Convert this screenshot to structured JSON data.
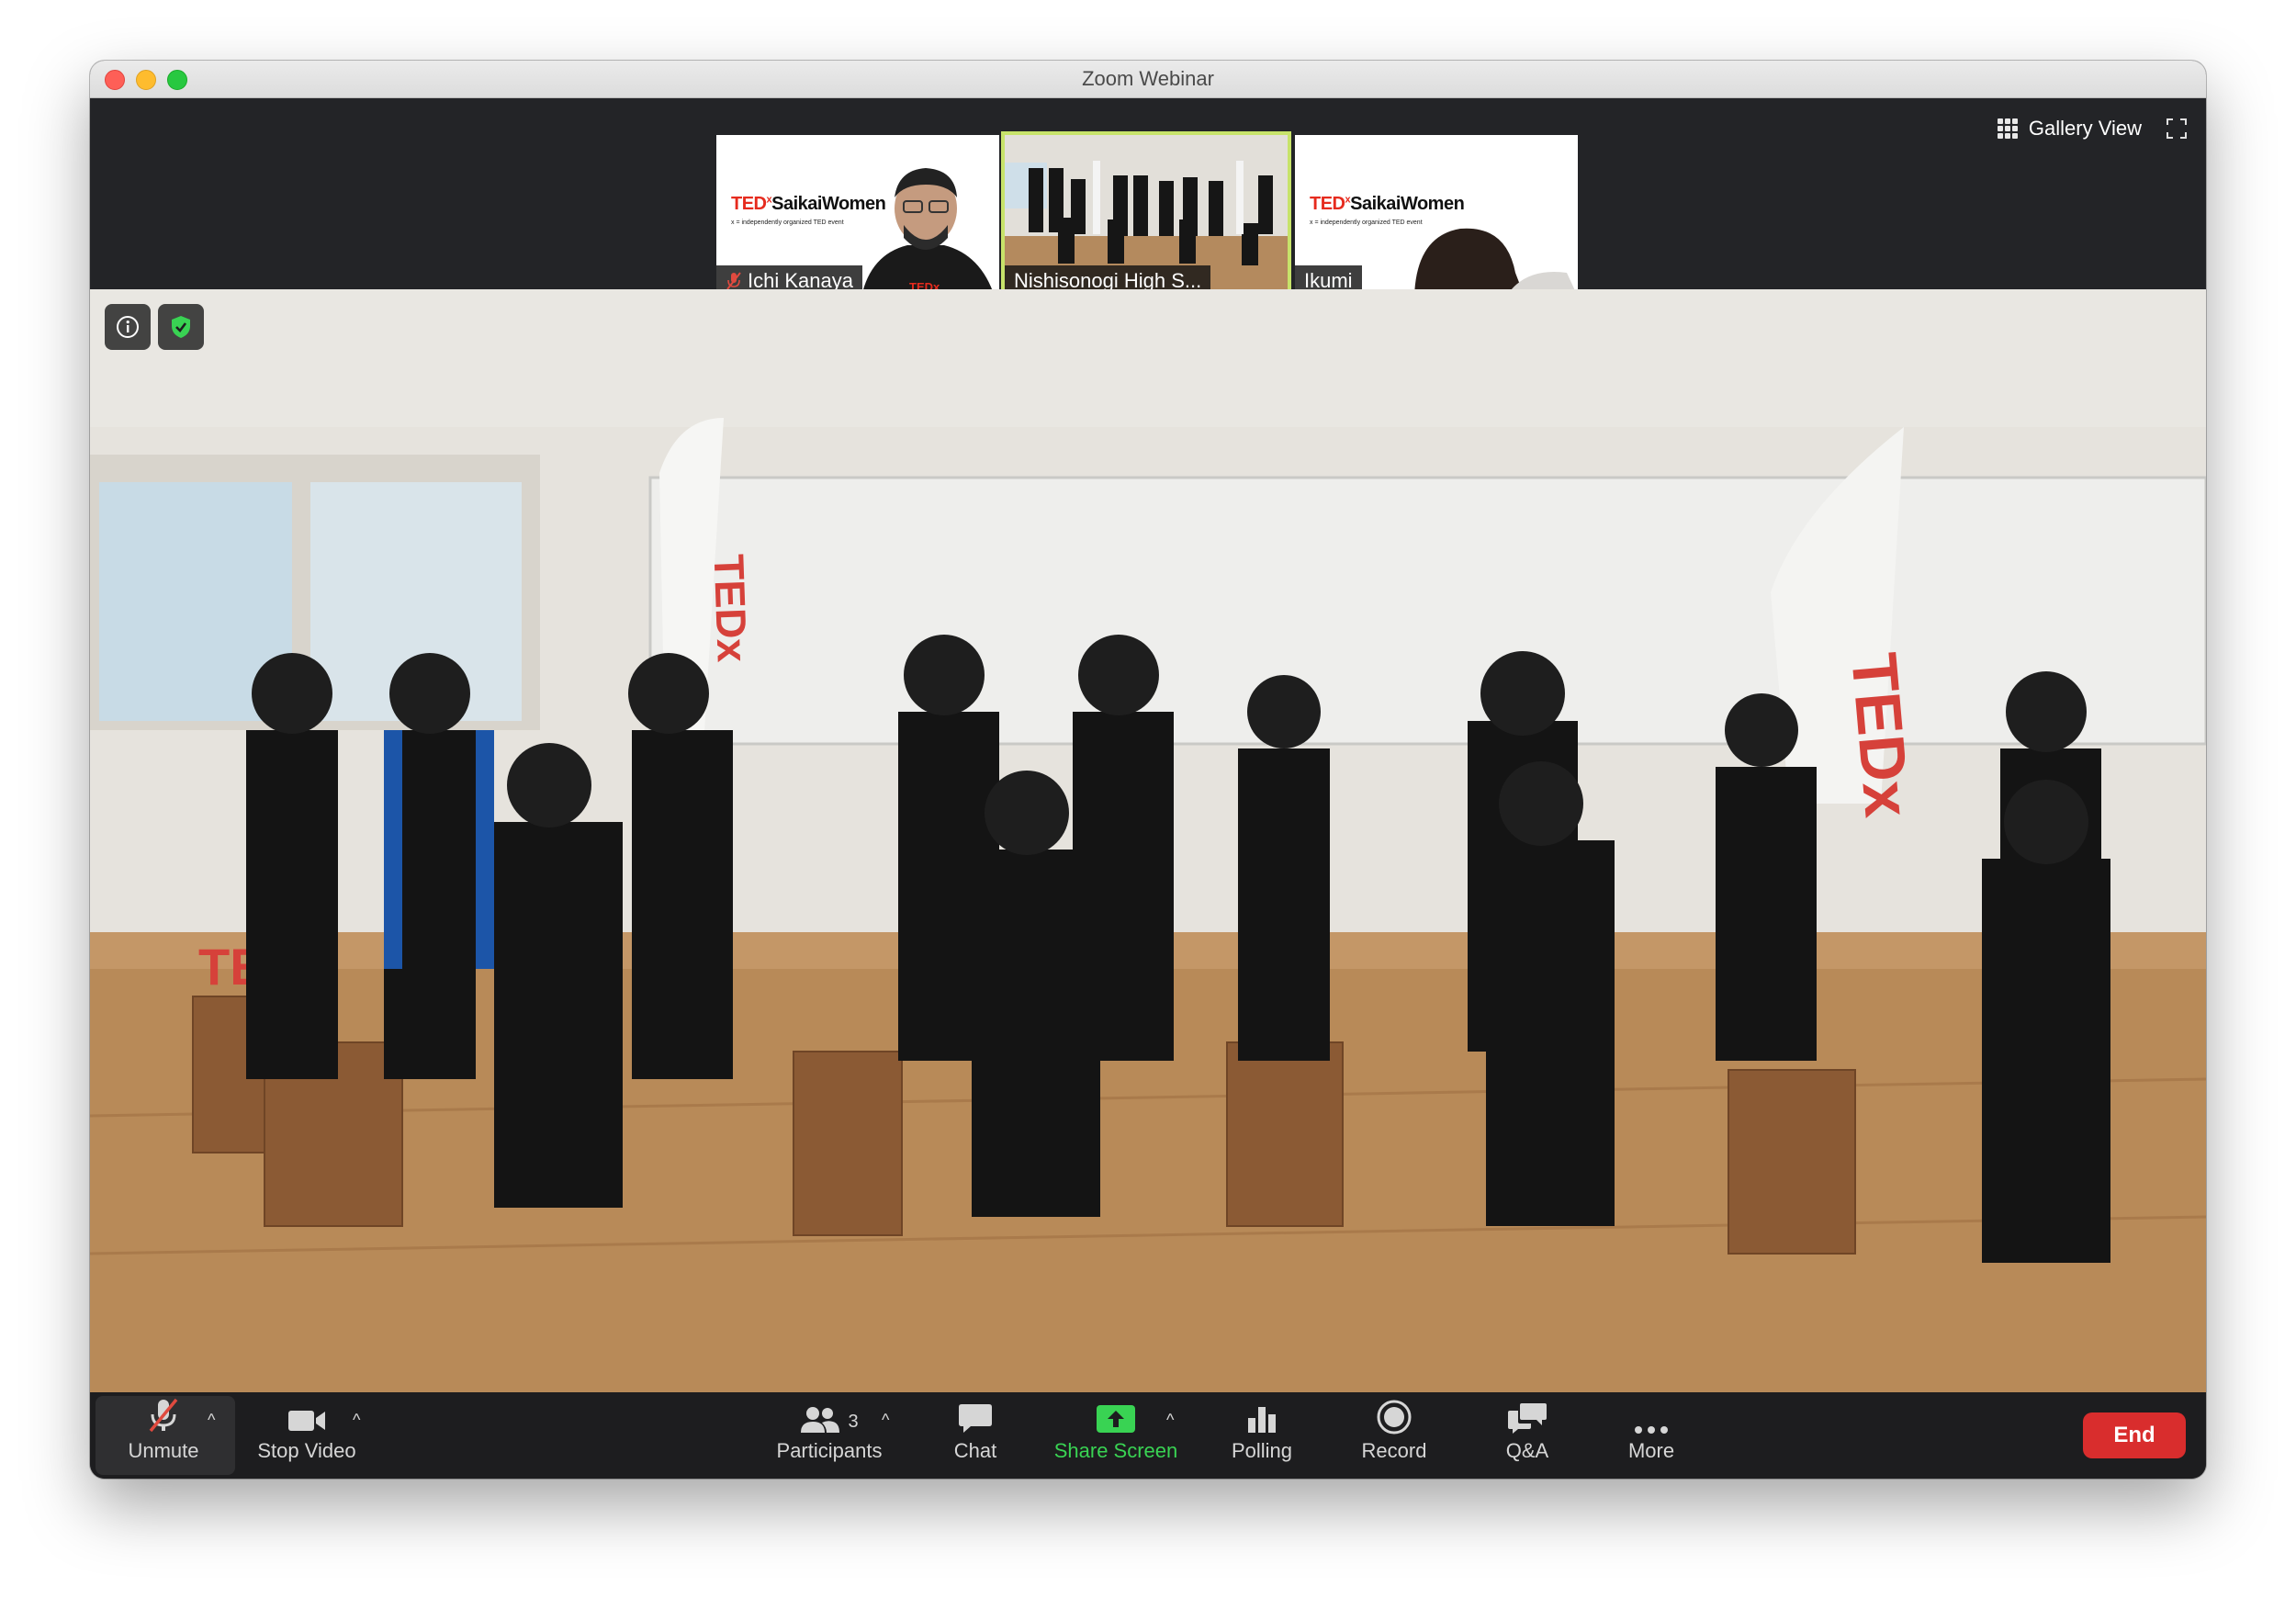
{
  "window": {
    "title": "Zoom Webinar"
  },
  "view": {
    "gallery_label": "Gallery View"
  },
  "thumbnails": [
    {
      "name": "Ichi Kanaya",
      "muted": true,
      "brand": "TEDxSaikaiWomen",
      "brand_sub": "x = independently organized TED event"
    },
    {
      "name": "Nishisonogi High S...",
      "active": true
    },
    {
      "name": "Ikumi",
      "brand": "TEDxSaikaiWomen",
      "brand_sub": "x = independently organized TED event"
    }
  ],
  "toolbar": {
    "unmute": "Unmute",
    "stop_video": "Stop Video",
    "participants": "Participants",
    "participants_count": "3",
    "chat": "Chat",
    "share_screen": "Share Screen",
    "polling": "Polling",
    "record": "Record",
    "qa": "Q&A",
    "more": "More",
    "end": "End"
  },
  "colors": {
    "share_green": "#39d353",
    "end_red": "#d92d2d",
    "active_border": "#c7e36a",
    "tedx_red": "#e62b1e"
  }
}
